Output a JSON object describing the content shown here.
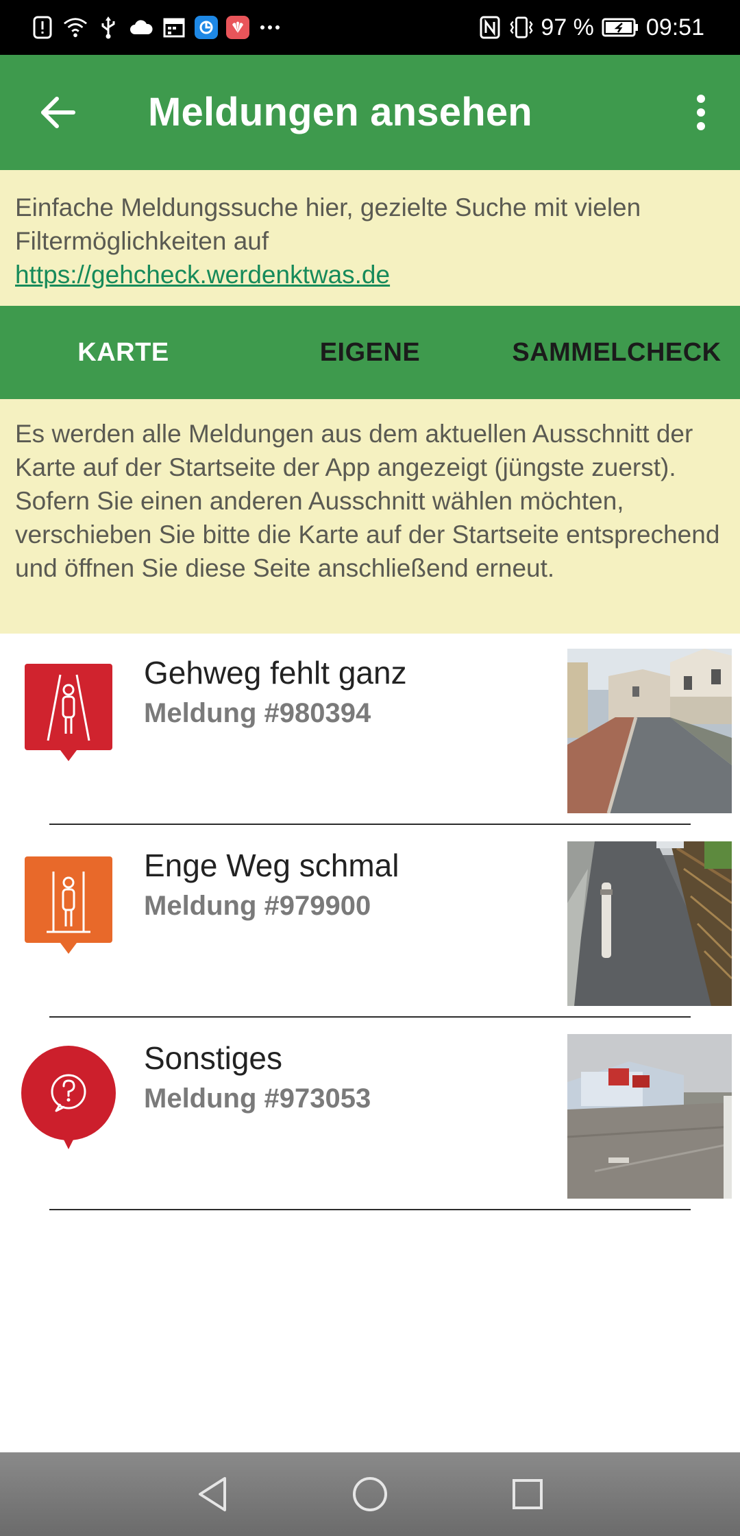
{
  "status_bar": {
    "battery": "97 %",
    "time": "09:51",
    "left_icons": [
      "alert-icon",
      "wifi-icon",
      "usb-icon",
      "cloud-icon",
      "calendar-icon",
      "app-blue-icon",
      "huawei-app-icon",
      "more-dots"
    ],
    "right_icons": [
      "nfc-icon",
      "vibrate-icon",
      "battery-icon"
    ]
  },
  "appbar": {
    "title": "Meldungen ansehen",
    "back_icon": "arrow-left-icon",
    "menu_icon": "more-vert-icon",
    "color": "#3e9a4d"
  },
  "info_banner": {
    "text": "Einfache Meldungssuche hier, gezielte Suche mit vielen Filtermöglichkeiten auf",
    "link": "https://gehcheck.werdenktwas.de"
  },
  "tabs": [
    {
      "label": "KARTE",
      "active": true
    },
    {
      "label": "EIGENE",
      "active": false
    },
    {
      "label": "SAMMELCHECK",
      "active": false
    }
  ],
  "info_map": {
    "text": "Es werden alle Meldungen aus dem aktuellen Ausschnitt der Karte auf der Startseite der App angezeigt (jüngste zuerst). Sofern Sie einen anderen Ausschnitt wählen möchten, verschieben Sie bitte die Karte auf der Startseite entsprechend und öffnen Sie diese Seite anschließend erneut."
  },
  "reports": [
    {
      "title": "Gehweg fehlt ganz",
      "subtitle": "Meldung #980394",
      "icon": "missing-sidewalk-icon",
      "color": "#d0232e"
    },
    {
      "title": "Enge Weg schmal",
      "subtitle": "Meldung #979900",
      "icon": "narrow-path-icon",
      "color": "#e8692a"
    },
    {
      "title": "Sonstiges",
      "subtitle": "Meldung #973053",
      "icon": "question-icon",
      "color": "#cc1f2c"
    }
  ],
  "nav": [
    "back-nav-icon",
    "home-nav-icon",
    "recents-nav-icon"
  ]
}
